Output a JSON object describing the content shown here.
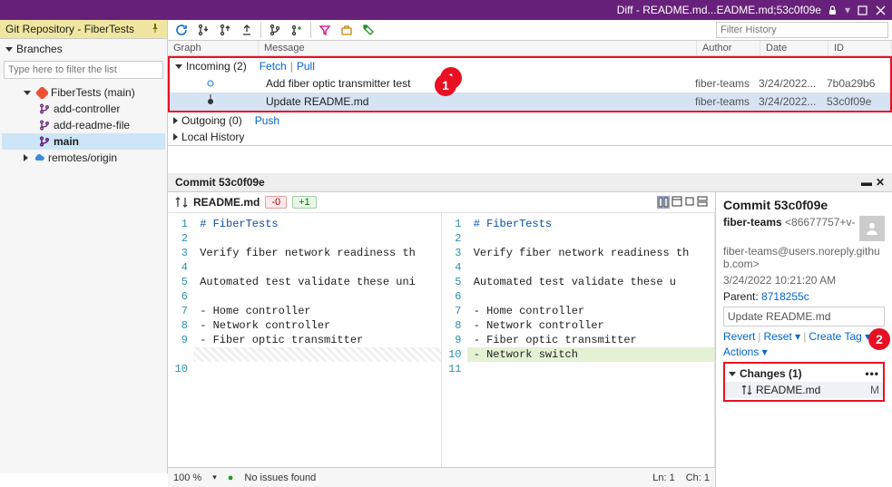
{
  "titlebar": {
    "diff_label": "Diff - README.md...EADME.md;53c0f09e"
  },
  "left": {
    "tab": "Git Repository - FiberTests",
    "branches_label": "Branches",
    "filter_placeholder": "Type here to filter the list",
    "repo": "FiberTests (main)",
    "branches": [
      "add-controller",
      "add-readme-file",
      "main"
    ],
    "remotes": "remotes/origin"
  },
  "toolbar": {
    "filter_placeholder": "Filter History"
  },
  "grid": {
    "headers": {
      "graph": "Graph",
      "message": "Message",
      "author": "Author",
      "date": "Date",
      "id": "ID"
    },
    "groups": {
      "incoming": {
        "label": "Incoming (2)",
        "links": [
          "Fetch",
          "Pull"
        ]
      },
      "outgoing": {
        "label": "Outgoing (0)",
        "push": "Push"
      },
      "local": {
        "label": "Local History"
      }
    },
    "commits": [
      {
        "msg": "Add fiber optic transmitter test",
        "author": "fiber-teams",
        "date": "3/24/2022...",
        "id": "7b0a29b6"
      },
      {
        "msg": "Update README.md",
        "author": "fiber-teams",
        "date": "3/24/2022...",
        "id": "53c0f09e"
      }
    ]
  },
  "diff": {
    "tab": "Commit 53c0f09e",
    "file": "README.md",
    "removed": "-0",
    "added": "+1",
    "left_lines": [
      "# FiberTests",
      "",
      "Verify fiber network readiness th",
      "",
      "Automated test validate these uni",
      "",
      "- Home controller",
      "- Network controller",
      "- Fiber optic transmitter",
      "",
      ""
    ],
    "left_nums": [
      "1",
      "2",
      "3",
      "4",
      "5",
      "6",
      "7",
      "8",
      "9",
      "",
      "10"
    ],
    "right_lines": [
      "# FiberTests",
      "",
      "Verify fiber network readiness th",
      "",
      "Automated test validate these u",
      "",
      "- Home controller",
      "- Network controller",
      "- Fiber optic transmitter",
      "- Network switch",
      ""
    ],
    "right_nums": [
      "1",
      "2",
      "3",
      "4",
      "5",
      "6",
      "7",
      "8",
      "9",
      "10",
      "11"
    ]
  },
  "details": {
    "title": "Commit 53c0f09e",
    "author": "fiber-teams",
    "author_id": "<86677757+v-",
    "email": "fiber-teams@users.noreply.github.com>",
    "date": "3/24/2022 10:21:20 AM",
    "parent_label": "Parent:",
    "parent": "8718255c",
    "message": "Update README.md",
    "actions": [
      "Revert",
      "Reset ▾",
      "Create Tag ▾",
      "Actions ▾"
    ],
    "changes_label": "Changes (1)",
    "changed_file": "README.md",
    "status": "M"
  },
  "statusbar": {
    "zoom": "100 %",
    "issues": "No issues found",
    "line": "Ln: 1",
    "col": "Ch: 1"
  },
  "annotations": {
    "one": "1",
    "two": "2"
  }
}
